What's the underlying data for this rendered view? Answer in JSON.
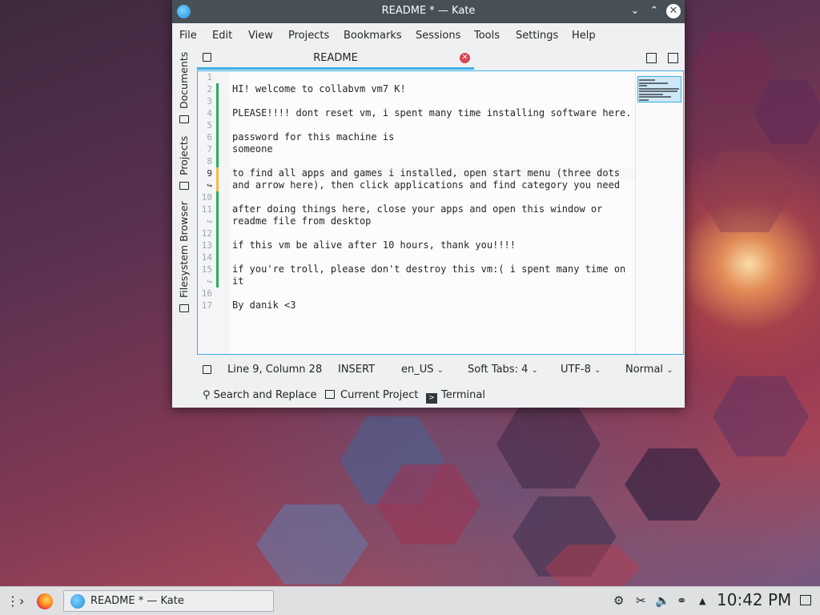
{
  "window": {
    "title": "README * — Kate",
    "buttons": {
      "minimize": "⌄",
      "maximize": "⌃",
      "close": "✕"
    }
  },
  "menu": [
    "File",
    "Edit",
    "View",
    "Projects",
    "Bookmarks",
    "Sessions",
    "Tools",
    "Settings",
    "Help"
  ],
  "sidebar": {
    "tabs": [
      "Documents",
      "Projects",
      "Filesystem Browser"
    ]
  },
  "tab": {
    "label": "README",
    "close": "✕"
  },
  "editor": {
    "line_numbers": [
      "1",
      "2",
      "3",
      "4",
      "5",
      "6",
      "7",
      "8",
      "9",
      "↪",
      "10",
      "11",
      "↪",
      "12",
      "13",
      "14",
      "15",
      "↪",
      "16",
      "17"
    ],
    "lines": [
      "",
      "HI! welcome to collabvm vm7 K!",
      "",
      "PLEASE!!!! dont reset vm, i spent many time installing software here.",
      "",
      "password for this machine is",
      "someone",
      "",
      "to find all apps and games i installed, open start menu (three dots",
      "and arrow here), then click applications and find category you need",
      "",
      "after doing things here, close your apps and open this window or",
      "readme file from desktop",
      "",
      "if this vm be alive after 10 hours, thank you!!!!",
      "",
      "if you're troll, please don't destroy this vm:( i spent many time on",
      "it",
      "",
      "By danik <3"
    ]
  },
  "status": {
    "position": "Line 9, Column 28",
    "mode": "INSERT",
    "dictionary": "en_US",
    "indent": "Soft Tabs: 4",
    "encoding": "UTF-8",
    "syntax": "Normal"
  },
  "tools": {
    "search": "Search and Replace",
    "project": "Current Project",
    "terminal": "Terminal"
  },
  "taskbar": {
    "task_label": "README * — Kate",
    "clock": "10:42 PM"
  },
  "colors": {
    "accent": "#3daee9",
    "modified_green": "#27ae60",
    "modified_orange": "#f5b94a",
    "close_red": "#da4453"
  }
}
